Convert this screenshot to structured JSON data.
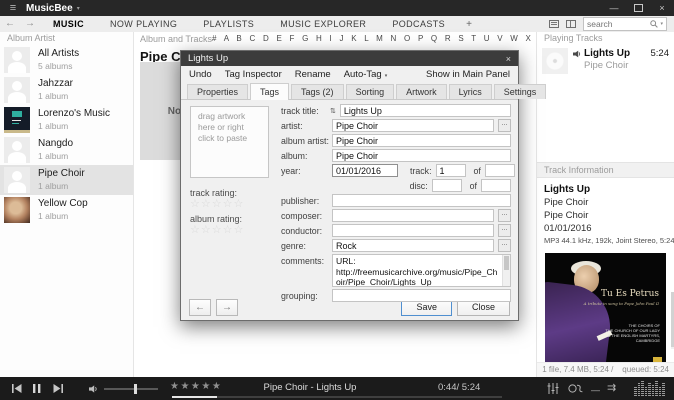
{
  "icons": {
    "hamburger": "≡",
    "title_caret": "▾",
    "minimize": "—",
    "close": "×",
    "back": "←",
    "forward": "→",
    "add_tab": "+",
    "search_caret": "▾",
    "dialog_close": "×",
    "auto_tag_caret": "▾",
    "updown": "⇅",
    "ellipsis": "...",
    "nav_prev": "←",
    "nav_next": "→",
    "repeat_dash": "—",
    "flow_arrows": "⇉"
  },
  "titlebar": {
    "app_title": "MusicBee"
  },
  "navbar": {
    "tabs": [
      {
        "label": "MUSIC",
        "active": true
      },
      {
        "label": "NOW PLAYING",
        "active": false
      },
      {
        "label": "PLAYLISTS",
        "active": false
      },
      {
        "label": "MUSIC EXPLORER",
        "active": false
      },
      {
        "label": "PODCASTS",
        "active": false
      }
    ],
    "search_placeholder": "search"
  },
  "sidebar": {
    "header": "Album Artist",
    "items": [
      {
        "name": "All Artists",
        "count": "5 albums",
        "avatar": "person",
        "selected": false
      },
      {
        "name": "Jahzzar",
        "count": "1 album",
        "avatar": "person",
        "selected": false
      },
      {
        "name": "Lorenzo's Music",
        "count": "1 album",
        "avatar": "art-dark",
        "selected": false
      },
      {
        "name": "Nangdo",
        "count": "1 album",
        "avatar": "person",
        "selected": false
      },
      {
        "name": "Pipe Choir",
        "count": "1 album",
        "avatar": "person",
        "selected": true
      },
      {
        "name": "Yellow Cop",
        "count": "1 album",
        "avatar": "photo",
        "selected": false
      }
    ]
  },
  "main": {
    "header": "Album and Tracks",
    "alphabet": "# A B C D E F G H I J K L M N O P Q R S T U V W X Y Z",
    "artist_heading": "Pipe Choir",
    "no_cover_label": "No Cover"
  },
  "dialog": {
    "title": "Lights Up",
    "menu": {
      "undo": "Undo",
      "tag_inspector": "Tag Inspector",
      "rename": "Rename",
      "auto_tag": "Auto-Tag",
      "show_in_main_panel": "Show in Main Panel"
    },
    "tabs": [
      {
        "label": "Properties",
        "active": false
      },
      {
        "label": "Tags",
        "active": true
      },
      {
        "label": "Tags (2)",
        "active": false
      },
      {
        "label": "Sorting",
        "active": false
      },
      {
        "label": "Artwork",
        "active": false
      },
      {
        "label": "Lyrics",
        "active": false
      },
      {
        "label": "Settings",
        "active": false
      }
    ],
    "artwork_hint": "drag artwork here or right click to paste",
    "track_rating_label": "track rating:",
    "album_rating_label": "album rating:",
    "rating_stars": "☆☆☆☆☆",
    "fields": {
      "track_title": {
        "label": "track title:",
        "value": "Lights Up"
      },
      "artist": {
        "label": "artist:",
        "value": "Pipe Choir"
      },
      "album_artist": {
        "label": "album artist:",
        "value": "Pipe Choir"
      },
      "album": {
        "label": "album:",
        "value": "Pipe Choir"
      },
      "year": {
        "label": "year:",
        "value": "01/01/2016"
      },
      "track_no": {
        "label": "track:",
        "value": "1",
        "of": "of",
        "of_value": ""
      },
      "disc_no": {
        "label": "disc:",
        "value": "",
        "of": "of",
        "of_value": ""
      },
      "publisher": {
        "label": "publisher:",
        "value": ""
      },
      "composer": {
        "label": "composer:",
        "value": ""
      },
      "conductor": {
        "label": "conductor:",
        "value": ""
      },
      "genre": {
        "label": "genre:",
        "value": "Rock"
      },
      "comments": {
        "label": "comments:",
        "value": "URL:\nhttp://freemusicarchive.org/music/Pipe_Choir/Pipe_Choir/Lights_Up"
      },
      "grouping": {
        "label": "grouping:",
        "value": ""
      }
    },
    "save_label": "Save",
    "close_label": "Close"
  },
  "right_panel": {
    "playing_header": "Playing Tracks",
    "queue": [
      {
        "title": "Lights Up",
        "artist": "Pipe Choir",
        "duration": "5:24"
      }
    ],
    "info_header": "Track Information",
    "info": {
      "title": "Lights Up",
      "artist": "Pipe Choir",
      "album": "Pipe Choir",
      "date": "01/01/2016",
      "format": "MP3 44.1 kHz, 192k, Joint Stereo, 5:24"
    },
    "album_art": {
      "title": "Tu Es Petrus",
      "subtitle": "A tribute in song to Pope John Paul II",
      "credit": "THE CHOIRS OF\nTHE CHURCH OF OUR LADY\n& THE ENGLISH MARTYRS,\nCAMBRIDGE"
    },
    "status": "1 file, 7.4 MB, 5:24 /    queued: 5:24"
  },
  "player": {
    "rating_stars": "★★★★★",
    "track_label": "Pipe Choir - Lights Up",
    "time": "0:44/ 5:24",
    "progress_percent": 13.6,
    "volume_percent": 55
  },
  "colors": {
    "accent_blue": "#4f8fd0",
    "titlebar": "#272727",
    "playerbar": "#1b1b1b"
  }
}
